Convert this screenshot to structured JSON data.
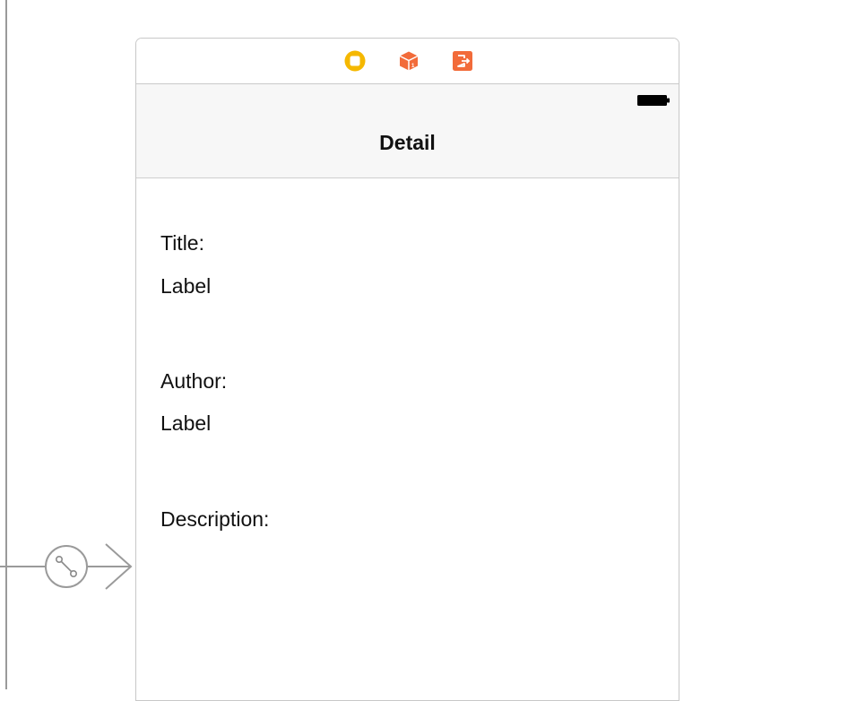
{
  "canvas": {
    "segue_icon": "segue-circle-icon",
    "arrow_icon": "entry-arrow-icon"
  },
  "scene": {
    "dock_icons": [
      "view-controller-icon",
      "first-responder-icon",
      "exit-icon"
    ],
    "status_bar": {
      "battery_icon": "battery-icon"
    },
    "navbar": {
      "title": "Detail"
    },
    "labels": {
      "title_caption": "Title:",
      "title_value": "Label",
      "author_caption": "Author:",
      "author_value": "Label",
      "description_caption": "Description:"
    },
    "colors": {
      "vc_icon": "#f5b800",
      "responder_icon": "#f26b3a",
      "exit_icon": "#f26b3a"
    }
  }
}
